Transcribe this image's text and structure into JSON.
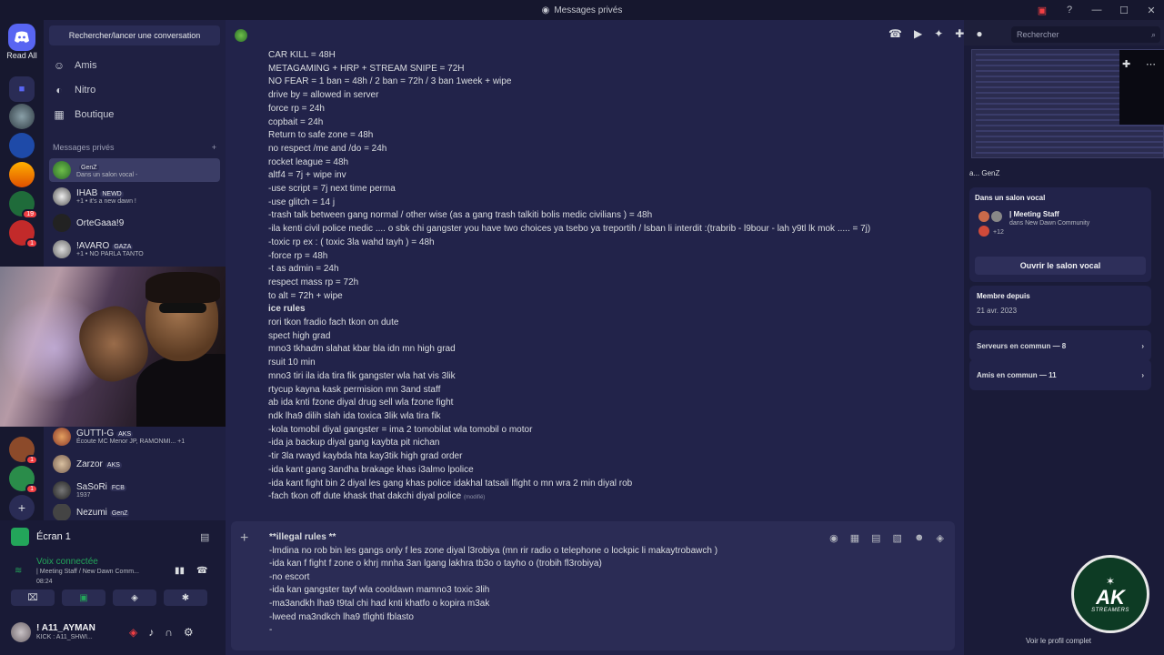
{
  "window": {
    "title": "Messages privés"
  },
  "servers": {
    "read_all": "Read All",
    "badges": [
      "19",
      "1",
      "1",
      "1"
    ]
  },
  "dm_sidebar": {
    "search_label": "Rechercher/lancer une conversation",
    "nav": [
      "Amis",
      "Nitro",
      "Boutique"
    ],
    "section_title": "Messages privés",
    "dms": [
      {
        "name": "",
        "tag": "GenZ",
        "status": "Dans un salon vocal -"
      },
      {
        "name": "IHAB",
        "tag": "NEWD",
        "status": "+1 • it's a new dawn !"
      },
      {
        "name": "OrteGaaa!9",
        "tag": "",
        "status": ""
      },
      {
        "name": "!AVARO",
        "tag": "GAZA",
        "status": "+1 • NO PARLA TANTO"
      },
      {
        "name": "GUTTI-G",
        "tag": "AKS",
        "status": "Écoute MC Menor JP, RAMONMI... +1"
      },
      {
        "name": "Zarzor",
        "tag": "AKS",
        "status": ""
      },
      {
        "name": "SaSoRi",
        "tag": "FCB",
        "status": "1937"
      },
      {
        "name": "Nezumi",
        "tag": "GenZ",
        "status": ""
      }
    ]
  },
  "user_panel": {
    "screen_label": "Écran 1",
    "voice_connected": "Voix connectée",
    "voice_channel": "| Meeting Staff / New Dawn Comm...",
    "voice_time": "08:24",
    "username": "! A11_AYMAN",
    "user_status": "KICK : A11_SHWI..."
  },
  "chat": {
    "lines": [
      "CAR KILL = 48H",
      "METAGAMING + HRP + STREAM SNIPE = 72H",
      "NO FEAR = 1 ban = 48h / 2 ban = 72h / 3 ban 1week + wipe",
      "drive by = allowed in server",
      "force rp = 24h",
      "copbait = 24h",
      "Return to safe zone = 48h",
      "no respect /me and /do = 24h",
      "rocket league = 48h",
      "altf4 = 7j + wipe inv",
      "-use script = 7j next time perma",
      "-use glitch = 14 j",
      "-trash talk between gang normal / other wise (as a gang trash talkiti bolis medic civilians ) = 48h",
      "-ila kenti civil police medic .... o sbk chi gangster you have two choices ya tsebo ya  treportih / lsban li interdit :(trabrib - l9bour - lah y9tl lk mok .....  = 7j)",
      "-toxic rp ex : ( toxic 3la wahd tayh )  = 48h",
      "-force rp = 48h",
      "-t as admin = 24h",
      "respect mass rp = 72h",
      " to alt = 72h + wipe",
      "ice rules",
      "rori tkon fradio fach tkon on dute",
      "spect high grad",
      "mno3 tkhadm slahat kbar bla idn mn high grad",
      "rsuit 10 min",
      "mno3 tiri ila ida tira fik gangster wla hat vis 3lik",
      "rtycup kayna kask permision mn 3and staff",
      "ab ida knti fzone diyal drug sell wla  fzone fight",
      "ndk lha9 dilih slah ida toxica 3lik wla tira fik",
      "-kola tomobil diyal gangster  = ima 2 tomobilat wla tomobil o motor",
      "-ida ja backup diyal gang kaybta pit nichan",
      "-tir 3la rwayd kaybda hta kay3tik high grad order",
      "-ida kant gang 3andha brakage khas i3almo lpolice",
      "-ida kant fight bin 2 diyal les gang khas police idakhal tatsali lfight o mn wra 2 min diyal rob",
      "-fach tkon off dute khask that dakchi diyal police"
    ],
    "modified_label": "(modifié)",
    "composer_lines": [
      "**illegal rules **",
      "-lmdina no rob bin les gangs only f les zone diyal l3robiya (mn rir radio o telephone o lockpic li makaytrobawch )",
      "-ida kan f fight f zone o khrj mnha 3an lgang lakhra tb3o o tayho o (trobih fl3robiya)",
      "-no escort",
      "-ida kan gangster tayf wla cooldawn mamno3 toxic 3lih",
      "-ma3andkh lha9 t9tal chi had knti khatfo o kopira m3ak",
      "-lweed ma3ndkch lha9 tfighti fblasto",
      "-"
    ]
  },
  "header": {
    "search_placeholder": "Rechercher"
  },
  "profile": {
    "name_line": "a... GenZ",
    "voice_title": "Dans un salon vocal",
    "voice_channel": "| Meeting Staff",
    "voice_server": "dans New Dawn Community",
    "voice_count": "+12",
    "open_voice": "Ouvrir le salon vocal",
    "member_since_label": "Membre depuis",
    "member_since": "21 avr. 2023",
    "servers_common": "Serveurs en commun — 8",
    "friends_common": "Amis en commun — 11",
    "full_profile": "Voir le profil complet"
  },
  "watermark": {
    "big": "AK",
    "small": "STREAMERS"
  },
  "colors": {
    "accent": "#5865f2",
    "online": "#23a55a",
    "danger": "#f23f43"
  }
}
